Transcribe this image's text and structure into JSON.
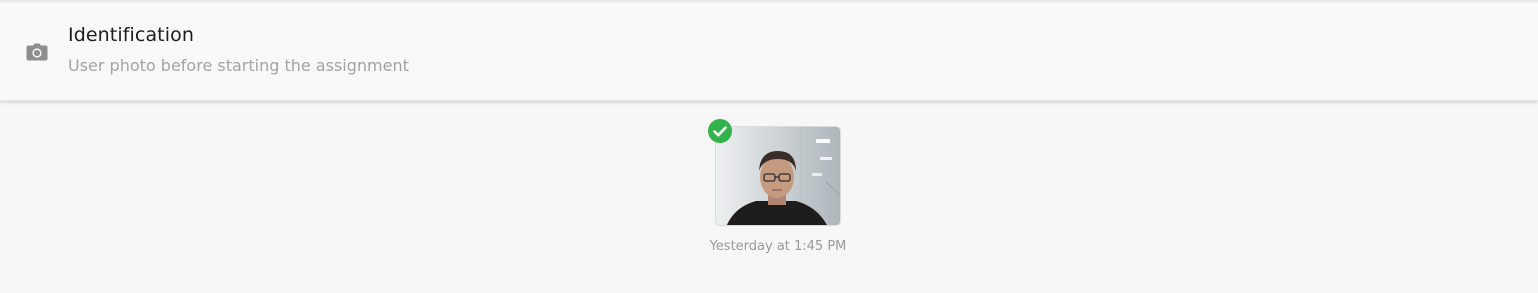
{
  "header": {
    "icon": "camera-icon",
    "title": "Identification",
    "subtitle": "User photo before starting the assignment"
  },
  "photo": {
    "status_icon": "check-circle-icon",
    "status_color": "#32b24a",
    "timestamp": "Yesterday at 1:45 PM"
  }
}
